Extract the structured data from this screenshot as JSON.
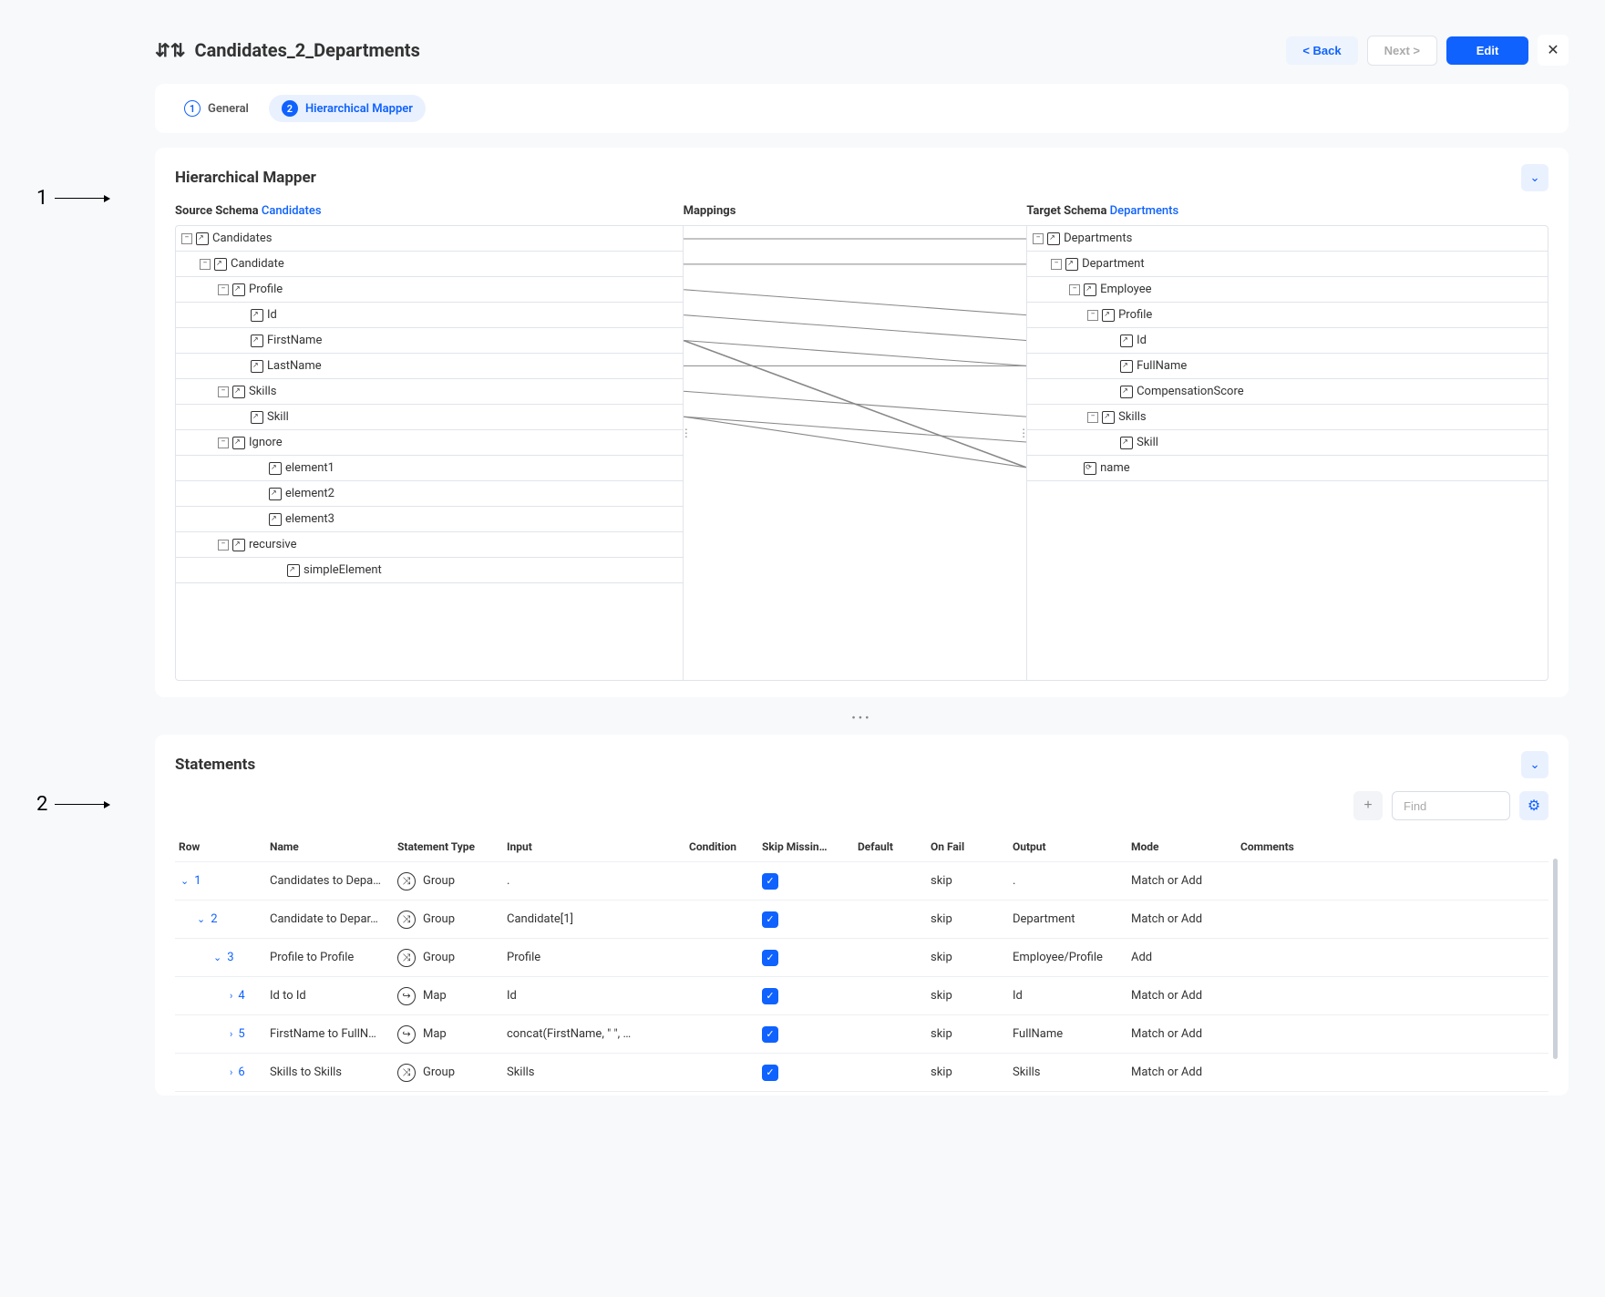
{
  "annotations": {
    "one": "1",
    "two": "2"
  },
  "header": {
    "title": "Candidates_2_Departments",
    "back_label": "< Back",
    "next_label": "Next >",
    "edit_label": "Edit"
  },
  "tabs": {
    "general": "General",
    "mapper": "Hierarchical Mapper",
    "step1": "1",
    "step2": "2"
  },
  "sections": {
    "mapper_title": "Hierarchical Mapper",
    "statements_title": "Statements"
  },
  "schema_labels": {
    "source_label": "Source Schema",
    "source_link": "Candidates",
    "mappings": "Mappings",
    "target_label": "Target Schema",
    "target_link": "Departments"
  },
  "source_tree": {
    "n0": "Candidates",
    "n1": "Candidate",
    "n2": "Profile",
    "n3": "Id",
    "n4": "FirstName",
    "n5": "LastName",
    "n6": "Skills",
    "n7": "Skill",
    "n8": "Ignore",
    "n9": "element1",
    "n10": "element2",
    "n11": "element3",
    "n12": "recursive",
    "n13": "simpleElement"
  },
  "target_tree": {
    "n0": "Departments",
    "n1": "Department",
    "n2": "Employee",
    "n3": "Profile",
    "n4": "Id",
    "n5": "FullName",
    "n6": "CompensationScore",
    "n7": "Skills",
    "n8": "Skill",
    "n9": "name"
  },
  "toolbar": {
    "find_placeholder": "Find"
  },
  "columns": {
    "row": "Row",
    "name": "Name",
    "type": "Statement Type",
    "input": "Input",
    "condition": "Condition",
    "skip": "Skip Missin…",
    "default": "Default",
    "onfail": "On Fail",
    "output": "Output",
    "mode": "Mode",
    "comments": "Comments"
  },
  "rows": [
    {
      "num": "1",
      "name": "Candidates to Depa…",
      "type": "Group",
      "type_kind": "group",
      "input": ".",
      "onfail": "skip",
      "output": ".",
      "mode": "Match or Add",
      "indent": 0,
      "open": true
    },
    {
      "num": "2",
      "name": "Candidate to Depar…",
      "type": "Group",
      "type_kind": "group",
      "input": "Candidate[1]",
      "onfail": "skip",
      "output": "Department",
      "mode": "Match or Add",
      "indent": 1,
      "open": true
    },
    {
      "num": "3",
      "name": "Profile to Profile",
      "type": "Group",
      "type_kind": "group",
      "input": "Profile",
      "onfail": "skip",
      "output": "Employee/Profile",
      "mode": "Add",
      "indent": 2,
      "open": true
    },
    {
      "num": "4",
      "name": "Id to Id",
      "type": "Map",
      "type_kind": "map",
      "input": "Id",
      "onfail": "skip",
      "output": "Id",
      "mode": "Match or Add",
      "indent": 3,
      "open": false
    },
    {
      "num": "5",
      "name": "FirstName to FullN…",
      "type": "Map",
      "type_kind": "map",
      "input": "concat(FirstName, \" \", …",
      "onfail": "skip",
      "output": "FullName",
      "mode": "Match or Add",
      "indent": 3,
      "open": false
    },
    {
      "num": "6",
      "name": "Skills to Skills",
      "type": "Group",
      "type_kind": "group",
      "input": "Skills",
      "onfail": "skip",
      "output": "Skills",
      "mode": "Match or Add",
      "indent": 3,
      "open": false
    }
  ]
}
